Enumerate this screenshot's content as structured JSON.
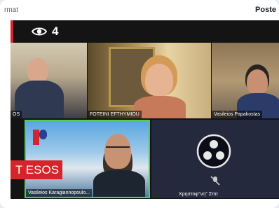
{
  "topbar": {
    "left_text": "rmat",
    "right_text": "Poste"
  },
  "overlay": {
    "viewer_count": "4",
    "ticker_text": "T ESOS"
  },
  "participants": [
    {
      "name": "OS"
    },
    {
      "name": "FOTEINI EFTHYMIOU"
    },
    {
      "name": "Vasileios Papakostas"
    },
    {
      "name": "Vasileios Karagiannopoulo..."
    },
    {
      "name": "Χρηστοφ°νη° Σπιτ"
    }
  ],
  "colors": {
    "active_speaker": "#4fd14f",
    "ticker_bg": "#d4262a"
  }
}
